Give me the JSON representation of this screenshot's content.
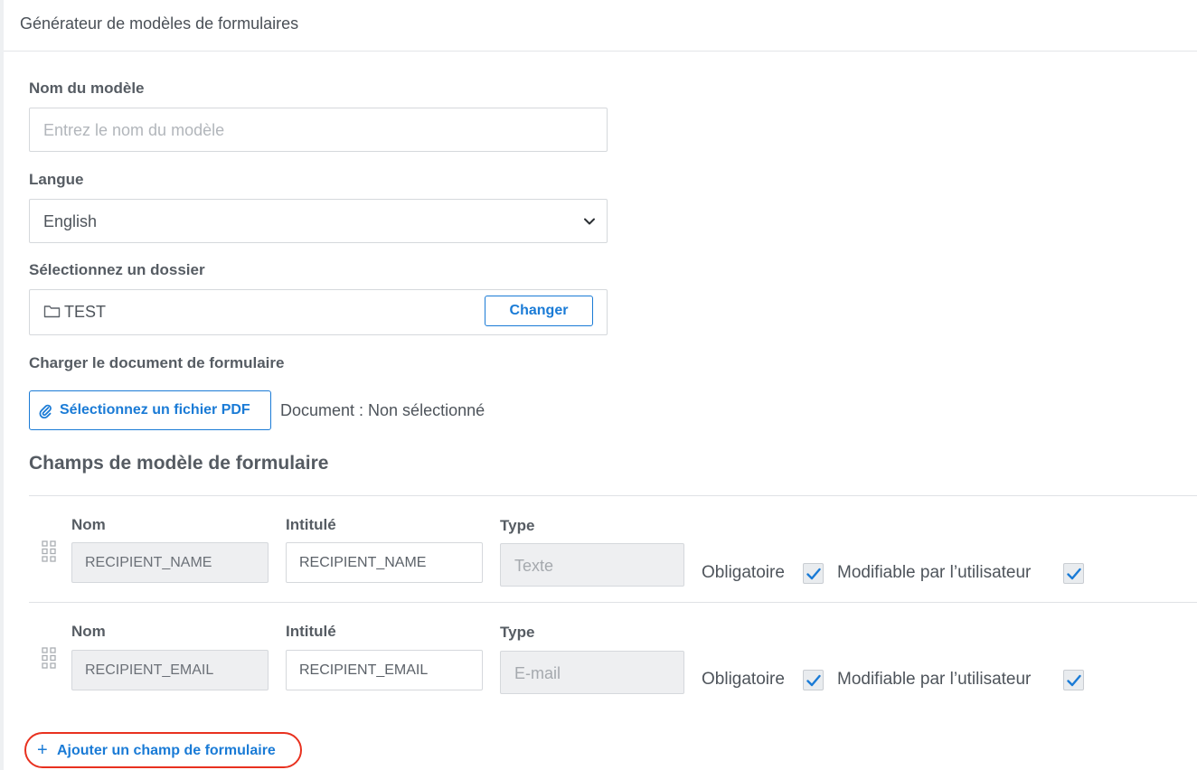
{
  "header": {
    "title": "Générateur de modèles de formulaires"
  },
  "template_name": {
    "label": "Nom du modèle",
    "placeholder": "Entrez le nom du modèle",
    "value": ""
  },
  "language": {
    "label": "Langue",
    "selected": "English"
  },
  "folder": {
    "label": "Sélectionnez un dossier",
    "name": "TEST",
    "change_label": "Changer"
  },
  "upload": {
    "label": "Charger le document de formulaire",
    "button_label": "Sélectionnez un fichier PDF",
    "status": "Document : Non sélectionné"
  },
  "fields_section": {
    "title": "Champs de modèle de formulaire",
    "columns": {
      "name": "Nom",
      "title": "Intitulé",
      "type": "Type"
    },
    "required_label": "Obligatoire",
    "editable_label": "Modifiable par l’utilisateur",
    "rows": [
      {
        "name": "RECIPIENT_NAME",
        "title": "RECIPIENT_NAME",
        "type": "Texte",
        "required": true,
        "editable": true
      },
      {
        "name": "RECIPIENT_EMAIL",
        "title": "RECIPIENT_EMAIL",
        "type": "E-mail",
        "required": true,
        "editable": true
      }
    ],
    "add_label": "Ajouter un champ de formulaire"
  },
  "colors": {
    "accent": "#1a7bd6",
    "highlight": "#e8311f"
  },
  "icons": {
    "folder": "folder-icon",
    "chevron": "chevron-down-icon",
    "paperclip": "paperclip-icon",
    "drag": "drag-handle-icon",
    "check": "checkmark-icon",
    "plus": "plus-icon"
  }
}
